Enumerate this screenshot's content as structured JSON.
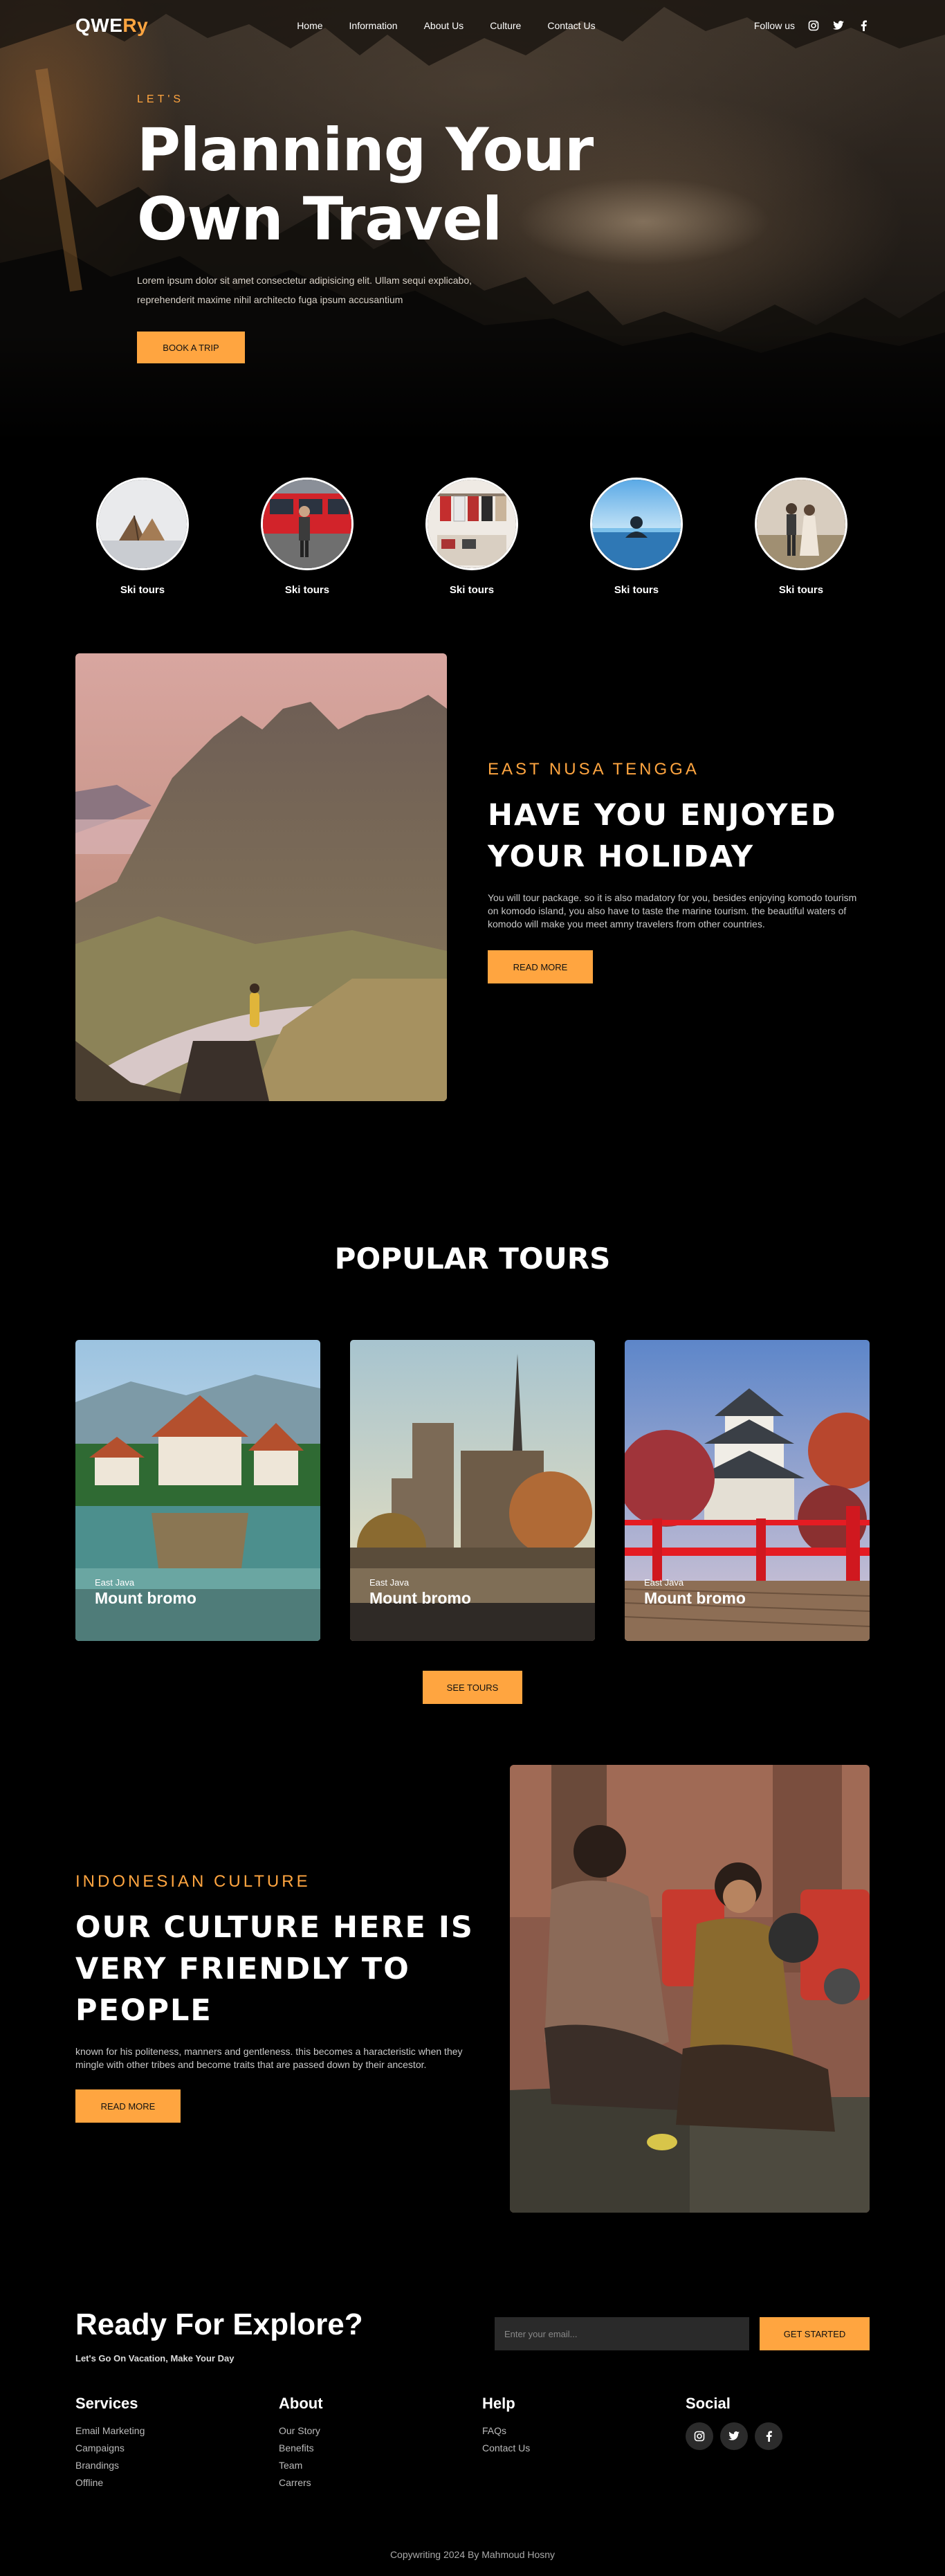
{
  "nav": {
    "logo_main": "QWE",
    "logo_accent": "Ry",
    "links": [
      "Home",
      "Information",
      "About Us",
      "Culture",
      "Contact Us"
    ],
    "follow_label": "Follow us",
    "socials": [
      "instagram-icon",
      "twitter-icon",
      "facebook-icon"
    ]
  },
  "hero": {
    "eyebrow": "LET'S",
    "title_line1": "Planning Your",
    "title_line2": "Own Travel",
    "text": "Lorem ipsum dolor sit amet consectetur adipisicing elit. Ullam sequi explicabo, reprehenderit maxime nihil architecto fuga ipsum accusantium",
    "button": "BOOK A TRIP"
  },
  "categories": [
    {
      "label": "Ski tours"
    },
    {
      "label": "Ski tours"
    },
    {
      "label": "Ski tours"
    },
    {
      "label": "Ski tours"
    },
    {
      "label": "Ski tours"
    }
  ],
  "holiday": {
    "eyebrow": "EAST NUSA TENGGA",
    "title_line1": "HAVE YOU ENJOYED",
    "title_line2": "YOUR HOLIDAY",
    "text": "You will tour package. so it is also madatory for you, besides enjoying komodo tourism on komodo island, you also have to taste the marine tourism. the beautiful waters of komodo will make you meet amny travelers from other countries.",
    "button": "READ MORE"
  },
  "tours": {
    "title": "POPULAR TOURS",
    "items": [
      {
        "sub": "East Java",
        "name": "Mount bromo"
      },
      {
        "sub": "East Java",
        "name": "Mount bromo"
      },
      {
        "sub": "East Java",
        "name": "Mount bromo"
      }
    ],
    "button": "SEE TOURS"
  },
  "culture": {
    "eyebrow": "INDONESIAN CULTURE",
    "title_line1": "OUR CULTURE HERE IS",
    "title_line2": "VERY FRIENDLY TO",
    "title_line3": "PEOPLE",
    "text": "known for his politeness, manners and gentleness. this becomes a haracteristic when they mingle with other tribes and become traits that are passed down by their ancestor.",
    "button": "READ MORE"
  },
  "cta": {
    "title": "Ready For Explore?",
    "sub": "Let's Go On Vacation, Make Your Day",
    "placeholder": "Enter your email...",
    "button": "GET STARTED"
  },
  "footer": {
    "services": {
      "title": "Services",
      "links": [
        "Email Marketing",
        "Campaigns",
        "Brandings",
        "Offline"
      ]
    },
    "about": {
      "title": "About",
      "links": [
        "Our Story",
        "Benefits",
        "Team",
        "Carrers"
      ]
    },
    "help": {
      "title": "Help",
      "links": [
        "FAQs",
        "Contact Us"
      ]
    },
    "social": {
      "title": "Social",
      "icons": [
        "instagram-icon",
        "twitter-icon",
        "facebook-icon"
      ]
    },
    "copyright": "Copywriting 2024 By Mahmoud Hosny"
  },
  "colors": {
    "accent": "#ffa540",
    "background": "#000000"
  }
}
